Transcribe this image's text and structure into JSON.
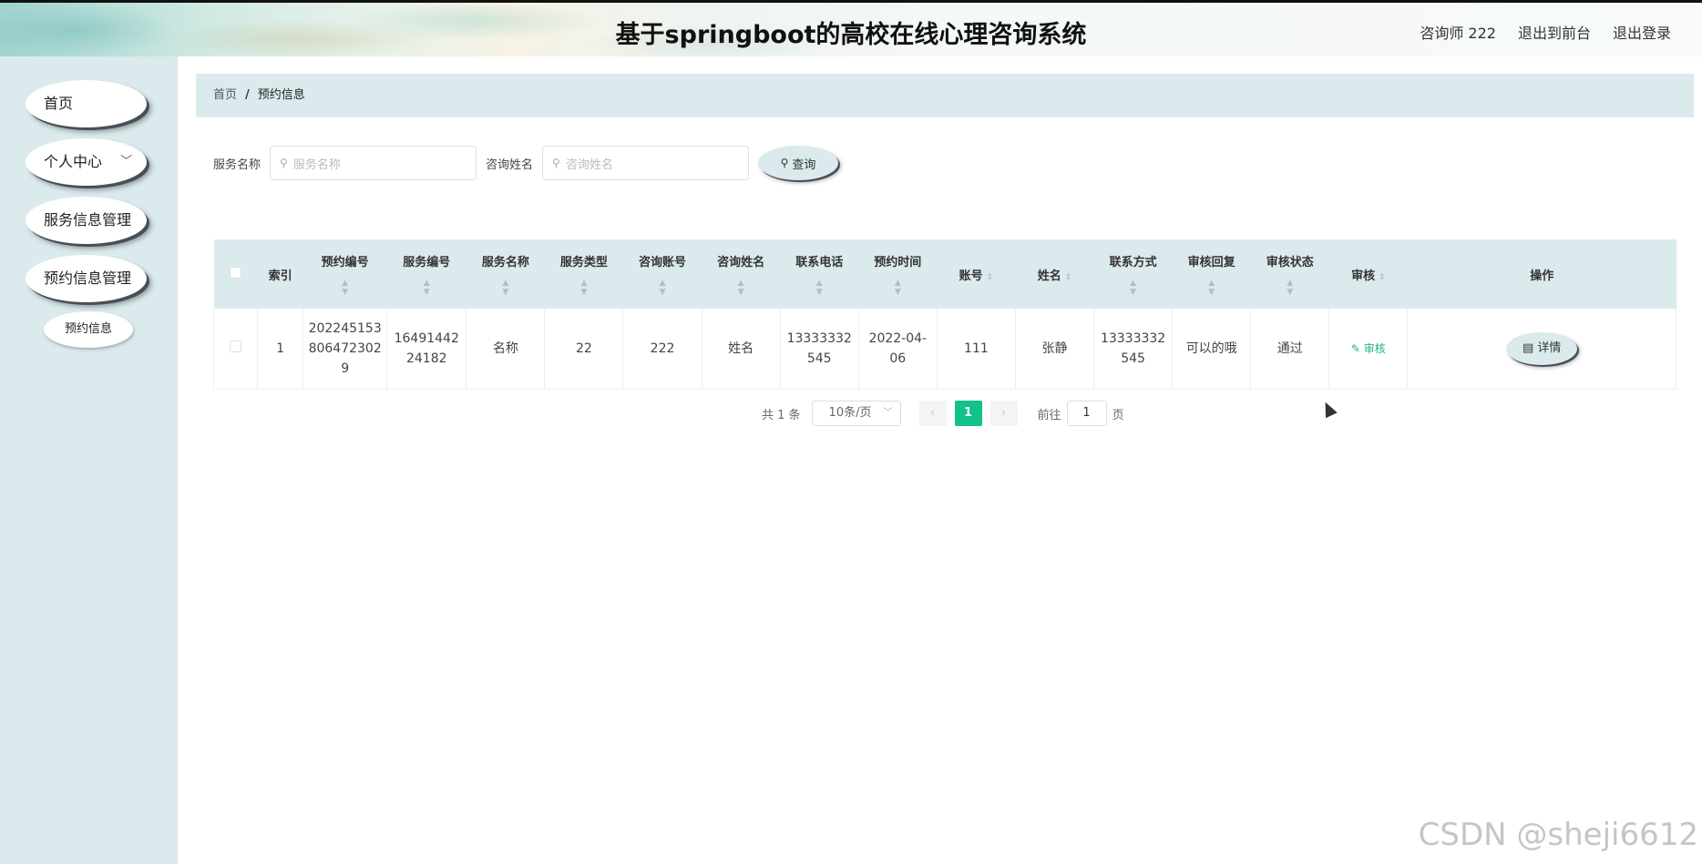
{
  "header": {
    "title": "基于springboot的高校在线心理咨询系统",
    "user": "咨询师 222",
    "front_link": "退出到前台",
    "logout": "退出登录"
  },
  "sidebar": {
    "items": [
      {
        "label": "首页"
      },
      {
        "label": "个人中心",
        "has_submenu": true
      },
      {
        "label": "服务信息管理"
      },
      {
        "label": "预约信息管理"
      }
    ],
    "sub_item": "预约信息",
    "chevron_icon": "chevron-down-icon"
  },
  "breadcrumb": {
    "home": "首页",
    "sep": "/",
    "current": "预约信息"
  },
  "search": {
    "field1_label": "服务名称",
    "field1_placeholder": "服务名称",
    "field2_label": "咨询姓名",
    "field2_placeholder": "咨询姓名",
    "button": "查询"
  },
  "table": {
    "headers": {
      "index": "索引",
      "booking_no": "预约编号",
      "service_no": "服务编号",
      "service_name": "服务名称",
      "service_type": "服务类型",
      "consult_account": "咨询账号",
      "consult_name": "咨询姓名",
      "phone": "联系电话",
      "booking_time": "预约时间",
      "account": "账号",
      "name": "姓名",
      "contact": "联系方式",
      "audit_reply": "审核回复",
      "audit_status": "审核状态",
      "audit": "审核",
      "ops": "操作"
    },
    "row": {
      "index": "1",
      "booking_no_1": "202245153",
      "booking_no_2": "806472302",
      "booking_no_3": "9",
      "service_no_1": "16491442",
      "service_no_2": "24182",
      "service_name": "名称",
      "service_type": "22",
      "consult_account": "222",
      "consult_name": "姓名",
      "phone_1": "13333332",
      "phone_2": "545",
      "booking_time_1": "2022-04-",
      "booking_time_2": "06",
      "account": "111",
      "name": "张静",
      "contact_1": "13333332",
      "contact_2": "545",
      "audit_reply": "可以的哦",
      "audit_status": "通过",
      "audit_action": "审核",
      "detail_button": "详情"
    }
  },
  "pagination": {
    "total": "共 1 条",
    "page_size": "10条/页",
    "current_page": "1",
    "goto_prefix": "前往",
    "goto_value": "1",
    "goto_suffix": "页"
  },
  "watermark": "CSDN @sheji6612",
  "colors": {
    "accent": "#13c18a",
    "panel": "#dbeaed",
    "audit_link": "#20b48a"
  }
}
